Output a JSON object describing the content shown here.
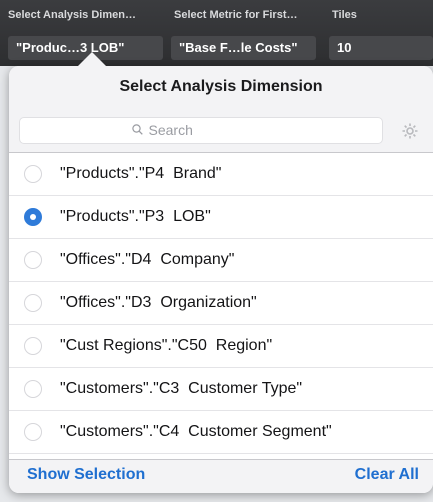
{
  "toolbar": {
    "dimension_label": "Select Analysis Dimen…",
    "dimension_value": "\"Produc…3  LOB\"",
    "metric_label": "Select Metric for First…",
    "metric_value": "\"Base F…le Costs\"",
    "tiles_label": "Tiles",
    "tiles_value": "10"
  },
  "popover": {
    "title": "Select Analysis Dimension",
    "search_placeholder": "Search",
    "options": [
      {
        "label": "\"Products\".\"P4  Brand\"",
        "selected": false
      },
      {
        "label": "\"Products\".\"P3  LOB\"",
        "selected": true
      },
      {
        "label": "\"Offices\".\"D4  Company\"",
        "selected": false
      },
      {
        "label": "\"Offices\".\"D3  Organization\"",
        "selected": false
      },
      {
        "label": "\"Cust Regions\".\"C50  Region\"",
        "selected": false
      },
      {
        "label": "\"Customers\".\"C3  Customer Type\"",
        "selected": false
      },
      {
        "label": "\"Customers\".\"C4  Customer Segment\"",
        "selected": false
      }
    ],
    "show_selection_label": "Show Selection",
    "clear_all_label": "Clear All"
  },
  "colors": {
    "accent": "#1f6fd0",
    "radio_selected": "#2f7bd9",
    "toolbar_bg": "#2d2e30"
  },
  "icons": {
    "search": "search-icon",
    "settings": "gear-icon"
  }
}
